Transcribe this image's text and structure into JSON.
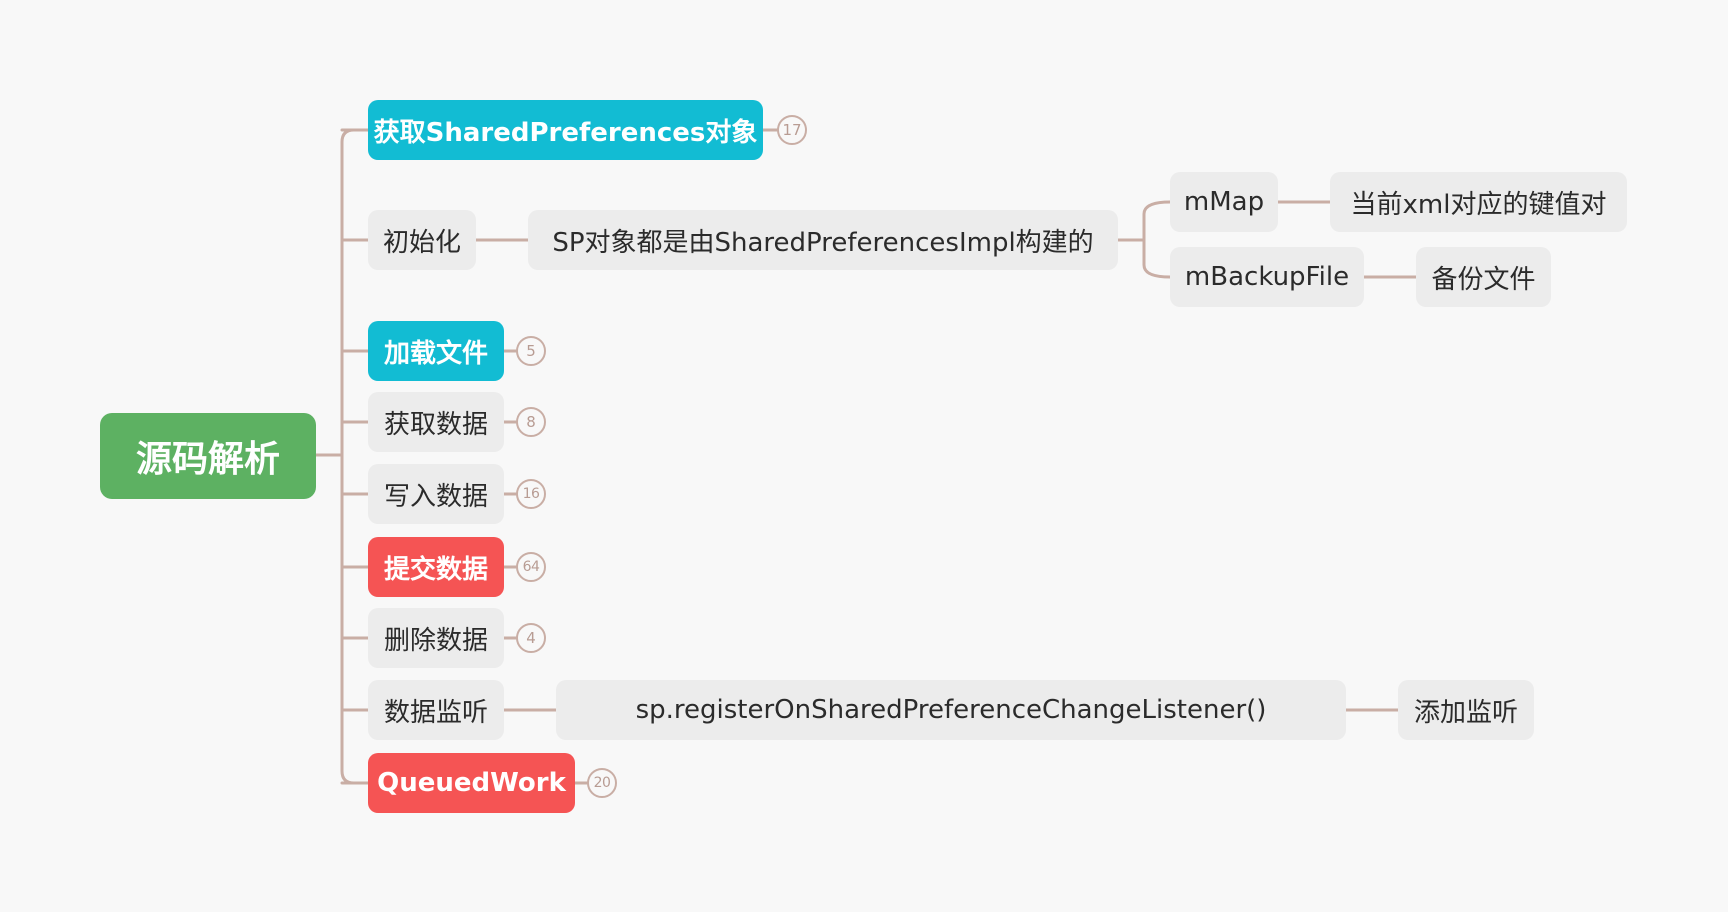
{
  "mindmap": {
    "root": {
      "label": "源码解析"
    },
    "branches": [
      {
        "id": "get-sp",
        "label": "获取SharedPreferences对象",
        "style": "cyan",
        "count": "17"
      },
      {
        "id": "init",
        "label": "初始化",
        "style": "plain",
        "children": [
          {
            "label": "SP对象都是由SharedPreferencesImpl构建的",
            "children": [
              {
                "label": "mMap",
                "children": [
                  {
                    "label": "当前xml对应的键值对"
                  }
                ]
              },
              {
                "label": "mBackupFile",
                "children": [
                  {
                    "label": "备份文件"
                  }
                ]
              }
            ]
          }
        ]
      },
      {
        "id": "load-file",
        "label": "加载文件",
        "style": "cyan",
        "count": "5"
      },
      {
        "id": "get-data",
        "label": "获取数据",
        "style": "plain",
        "count": "8"
      },
      {
        "id": "write-data",
        "label": "写入数据",
        "style": "plain",
        "count": "16"
      },
      {
        "id": "commit-data",
        "label": "提交数据",
        "style": "red",
        "count": "64"
      },
      {
        "id": "delete-data",
        "label": "删除数据",
        "style": "plain",
        "count": "4"
      },
      {
        "id": "listen-data",
        "label": "数据监听",
        "style": "plain",
        "children": [
          {
            "label": "sp.registerOnSharedPreferenceChangeListener()",
            "children": [
              {
                "label": "添加监听"
              }
            ]
          }
        ]
      },
      {
        "id": "queued-work",
        "label": "QueuedWork",
        "style": "red",
        "count": "20"
      }
    ],
    "colors": {
      "root": "#5db162",
      "cyan": "#12bcd3",
      "red": "#f55454",
      "plain": "#ececec",
      "connector": "#c9aea5"
    }
  }
}
